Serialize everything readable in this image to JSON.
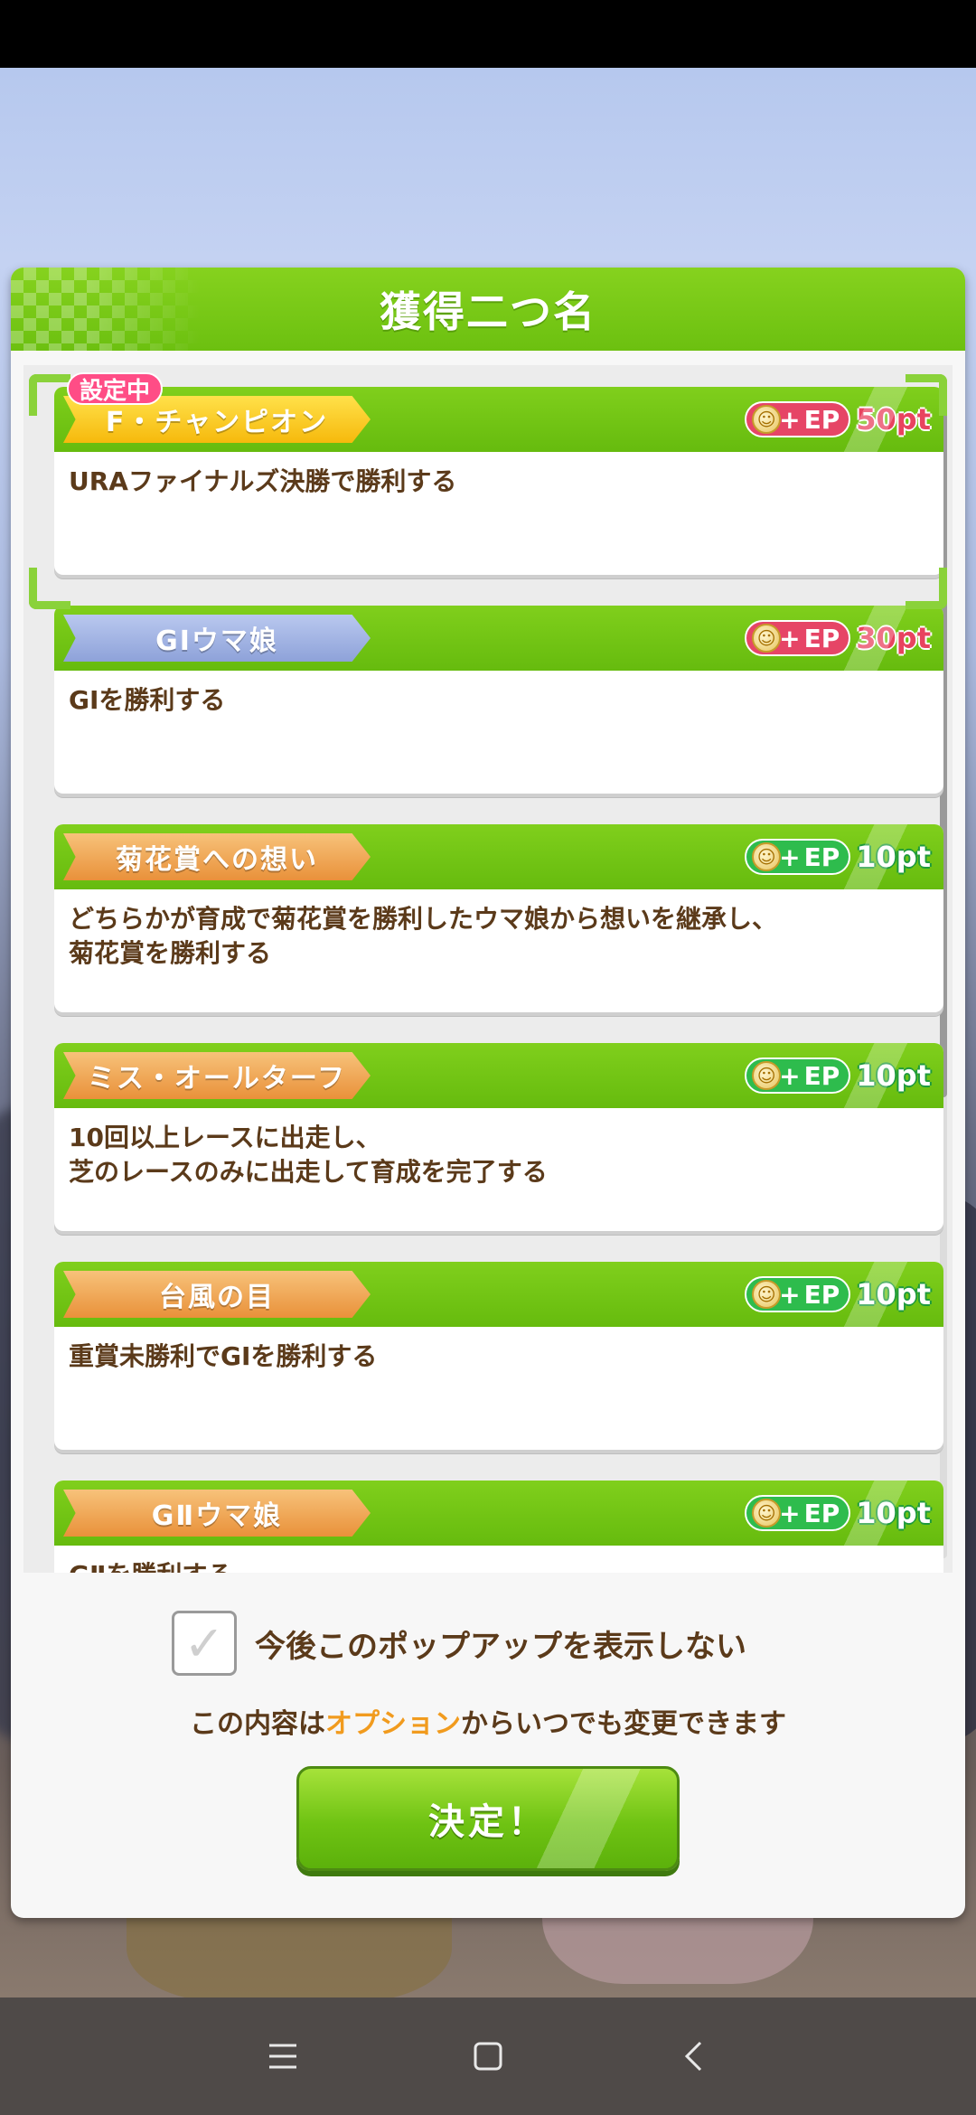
{
  "dialog": {
    "title": "獲得二つ名",
    "current_tag": "設定中"
  },
  "titles": [
    {
      "name": "F・チャンピオン",
      "badge": "gold",
      "ep_label": "EP",
      "pt": "50pt",
      "ep_color": "red",
      "description": "URAファイナルズ決勝で勝利する"
    },
    {
      "name": "GⅠウマ娘",
      "badge": "blue",
      "ep_label": "EP",
      "pt": "30pt",
      "ep_color": "red",
      "description": "GⅠを勝利する"
    },
    {
      "name": "菊花賞への想い",
      "badge": "orange",
      "ep_label": "EP",
      "pt": "10pt",
      "ep_color": "green",
      "description": "どちらかが育成で菊花賞を勝利したウマ娘から想いを継承し、\n菊花賞を勝利する"
    },
    {
      "name": "ミス・オールターフ",
      "badge": "orange",
      "ep_label": "EP",
      "pt": "10pt",
      "ep_color": "green",
      "description": "10回以上レースに出走し、\n芝のレースのみに出走して育成を完了する"
    },
    {
      "name": "台風の目",
      "badge": "orange",
      "ep_label": "EP",
      "pt": "10pt",
      "ep_color": "green",
      "description": "重賞未勝利でGⅠを勝利する"
    },
    {
      "name": "GⅡウマ娘",
      "badge": "orange",
      "ep_label": "EP",
      "pt": "10pt",
      "ep_color": "green",
      "description": "GⅡを勝利する"
    }
  ],
  "footer": {
    "checkbox_label": "今後このポップアップを表示しない",
    "info_before": "この内容は",
    "info_link": "オプション",
    "info_after": "からいつでも変更できます",
    "confirm_label": "決定！"
  },
  "nav": {
    "menu_icon": "☰",
    "home_icon": "▢",
    "back_icon": "‹"
  }
}
